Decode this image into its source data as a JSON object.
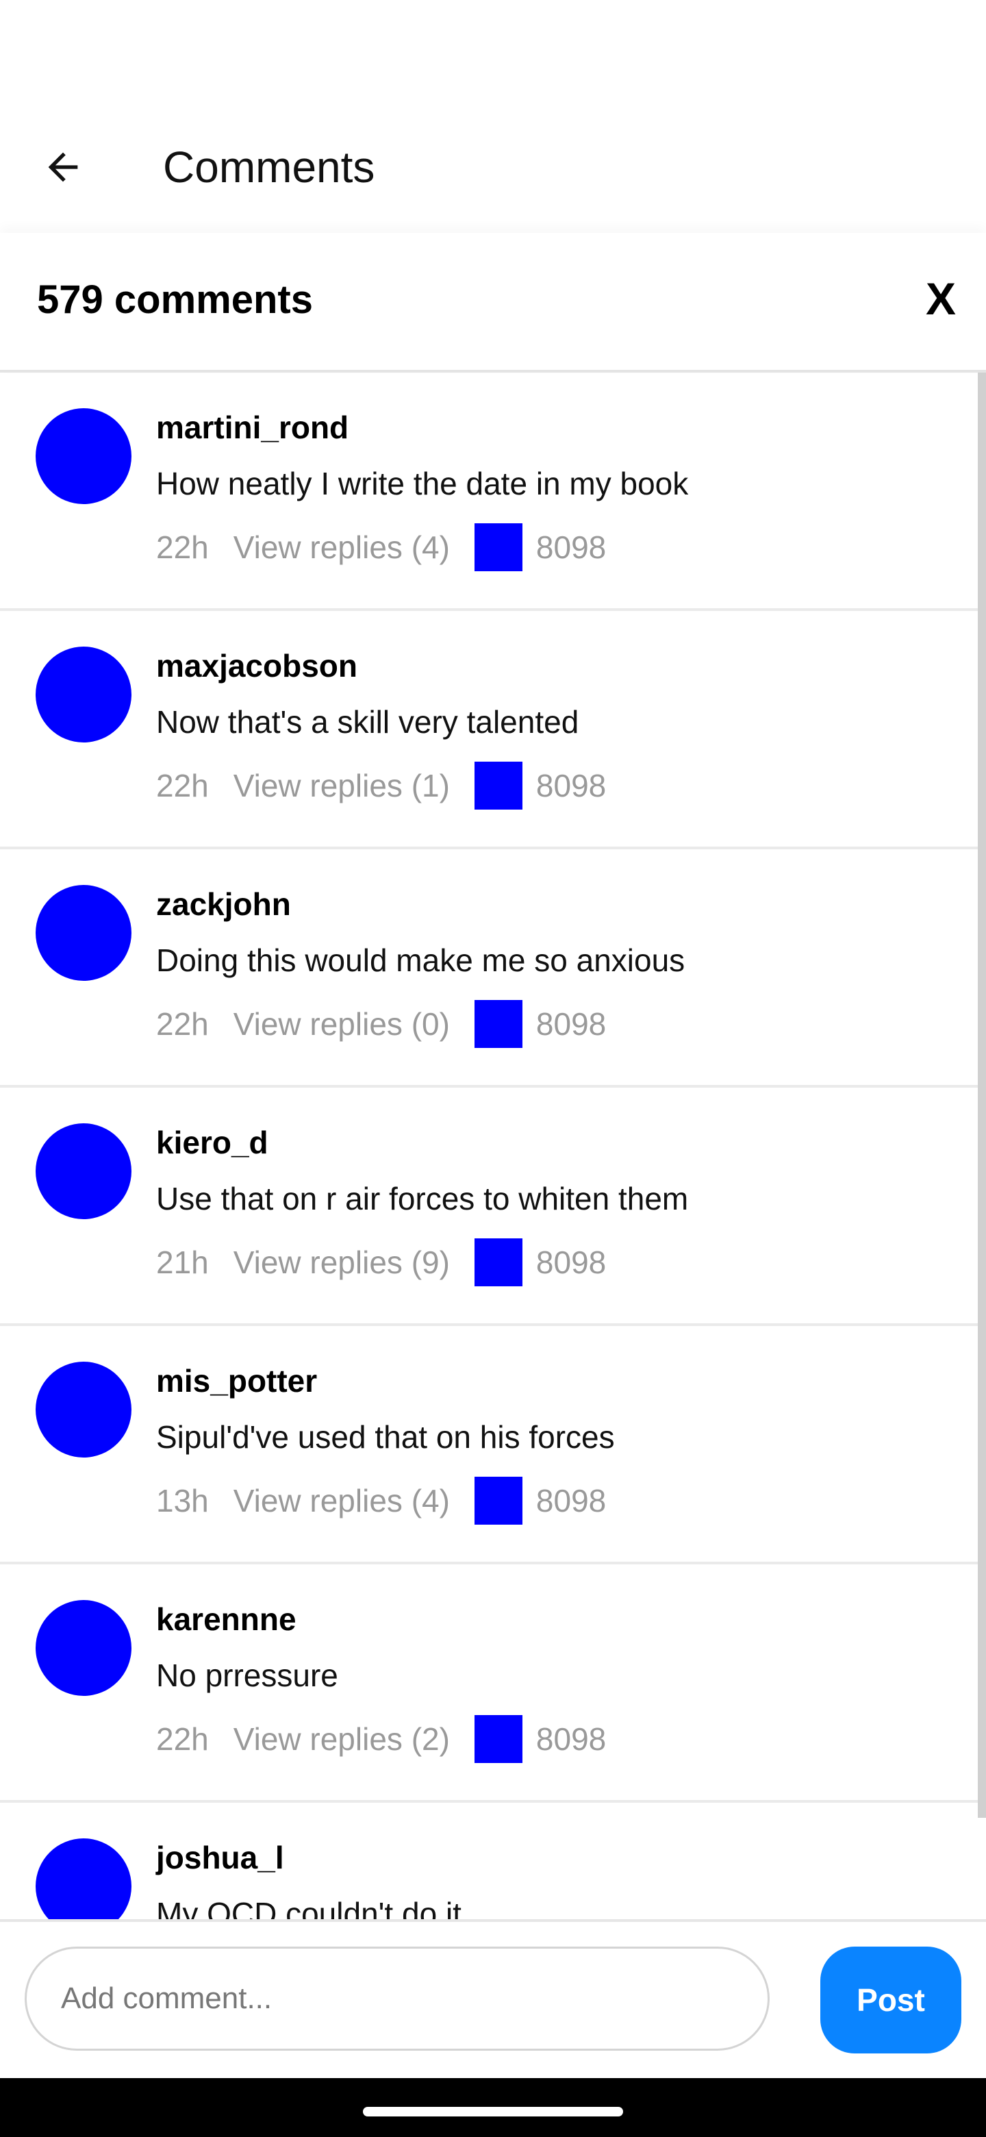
{
  "app_bar": {
    "title": "Comments"
  },
  "sheet": {
    "count_label": "579 comments",
    "close_label": "X"
  },
  "comments": [
    {
      "username": "martini_rond",
      "text": "How neatly I write the date in my book",
      "time": "22h",
      "replies": "View replies (4)",
      "likes": "8098"
    },
    {
      "username": "maxjacobson",
      "text": "Now that's a skill very talented",
      "time": "22h",
      "replies": "View replies (1)",
      "likes": "8098"
    },
    {
      "username": "zackjohn",
      "text": "Doing this would make me so anxious",
      "time": "22h",
      "replies": "View replies (0)",
      "likes": "8098"
    },
    {
      "username": "kiero_d",
      "text": "Use that on r air forces to whiten them",
      "time": "21h",
      "replies": "View replies (9)",
      "likes": "8098"
    },
    {
      "username": "mis_potter",
      "text": "Sipul'd've used that on his forces",
      "time": "13h",
      "replies": "View replies (4)",
      "likes": "8098"
    },
    {
      "username": "karennne",
      "text": "No prressure",
      "time": "22h",
      "replies": "View replies (2)",
      "likes": "8098"
    },
    {
      "username": "joshua_l",
      "text": "My OCD couldn't do it",
      "time": "",
      "replies": "",
      "likes": ""
    }
  ],
  "composer": {
    "placeholder": "Add comment...",
    "post_label": "Post"
  },
  "colors": {
    "avatar": "#0000ff",
    "like_icon": "#0000ff",
    "post_button": "#0a84ff"
  }
}
